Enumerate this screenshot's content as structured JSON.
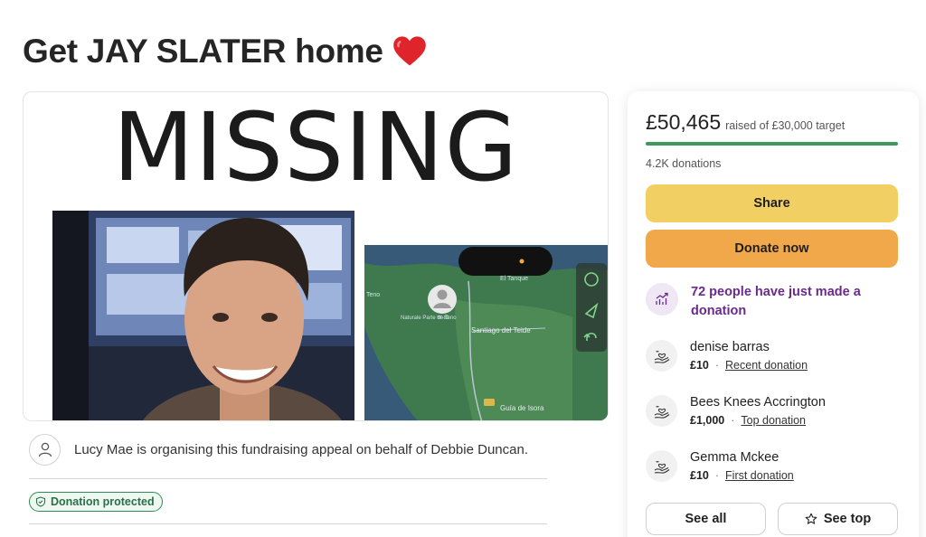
{
  "title": "Get JAY SLATER home",
  "title_emoji": "heart-emoji",
  "hero": {
    "poster_text": "MISSING",
    "map_labels": [
      "Teno",
      "El Tanque",
      "Santiago del Teide",
      "Guía de Isora",
      "Naturale Parte de Teno"
    ],
    "map_pin_label": "TF-82"
  },
  "organiser": {
    "text": "Lucy Mae is organising this fundraising appeal on behalf of Debbie Duncan."
  },
  "badge": {
    "label": "Donation protected"
  },
  "card": {
    "raised": "£50,465",
    "target_text": "raised of £30,000 target",
    "progress_fraction": 1.0,
    "donations": "4.2K donations",
    "share_label": "Share",
    "donate_label": "Donate now",
    "trend_text": "72 people have just made a donation",
    "donors": [
      {
        "name": "denise barras",
        "amount": "£10",
        "tag": "Recent donation"
      },
      {
        "name": "Bees Knees Accrington",
        "amount": "£1,000",
        "tag": "Top donation"
      },
      {
        "name": "Gemma Mckee",
        "amount": "£10",
        "tag": "First donation"
      }
    ],
    "see_all_label": "See all",
    "see_top_label": "See top"
  },
  "colors": {
    "progress": "#3e9a5a",
    "share_button": "#f2cf63",
    "donate_button": "#f1a84a",
    "trend_text": "#6b2a8a",
    "protected_badge": "#2e8b57"
  },
  "icons": [
    "heart-emoji",
    "person-icon",
    "shield-check-icon",
    "trending-up-icon",
    "hand-heart-icon",
    "star-icon"
  ]
}
